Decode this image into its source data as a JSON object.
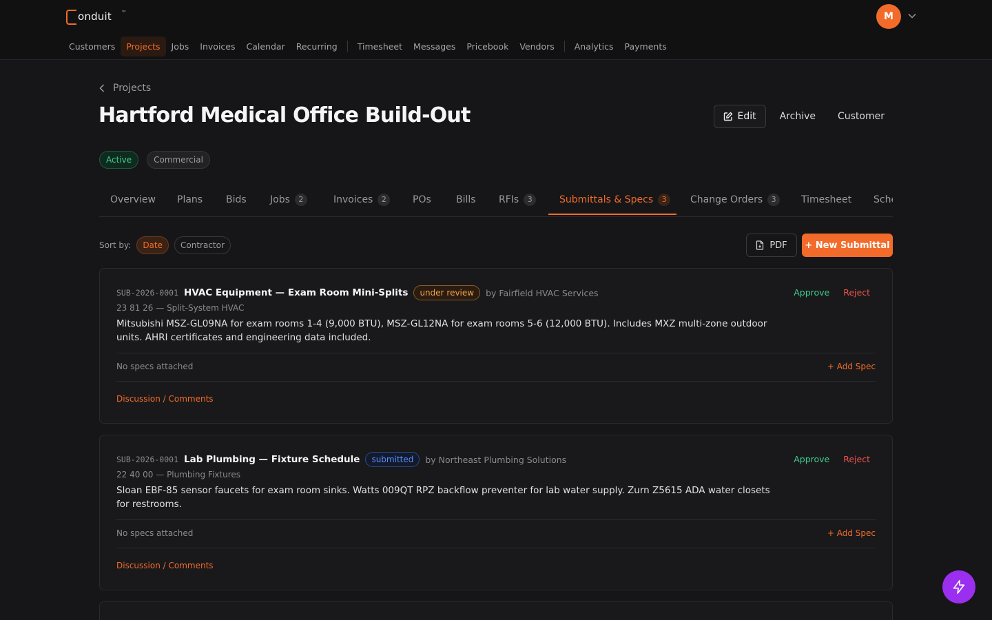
{
  "app": {
    "logo_text": "onduit",
    "logo_tm": "™",
    "avatar_initial": "M"
  },
  "nav": {
    "items": [
      "Customers",
      "Projects",
      "Jobs",
      "Invoices",
      "Calendar",
      "Recurring",
      "Timesheet",
      "Messages",
      "Pricebook",
      "Vendors",
      "Analytics",
      "Payments"
    ],
    "active": "Projects"
  },
  "project": {
    "back_label": "Projects",
    "title": "Hartford Medical Office Build-Out",
    "edit_label": "Edit",
    "archive_label": "Archive",
    "customer_label": "Customer",
    "status_badge": "Active",
    "type_badge": "Commercial"
  },
  "tabs": [
    {
      "label": "Overview",
      "count": null
    },
    {
      "label": "Plans",
      "count": null
    },
    {
      "label": "Bids",
      "count": null
    },
    {
      "label": "Jobs",
      "count": "2"
    },
    {
      "label": "Invoices",
      "count": "2"
    },
    {
      "label": "POs",
      "count": null
    },
    {
      "label": "Bills",
      "count": null
    },
    {
      "label": "RFIs",
      "count": "3"
    },
    {
      "label": "Submittals & Specs",
      "count": "3",
      "active": true
    },
    {
      "label": "Change Orders",
      "count": "3"
    },
    {
      "label": "Timesheet",
      "count": null
    },
    {
      "label": "Sche",
      "count": null
    }
  ],
  "toolbar": {
    "sort_label": "Sort by:",
    "sort_options": [
      "Date",
      "Contractor"
    ],
    "sort_active": "Date",
    "pdf_label": "PDF",
    "new_label": "+ New Submittal"
  },
  "submittals": [
    {
      "id": "SUB-2026-0001",
      "title": "HVAC Equipment — Exam Room Mini-Splits",
      "status": "under review",
      "byline": "by Fairfield HVAC Services",
      "spec_code": "23 81 26 — Split-System HVAC",
      "description": "Mitsubishi MSZ-GL09NA for exam rooms 1-4 (9,000 BTU), MSZ-GL12NA for exam rooms 5-6 (12,000 BTU). Includes MXZ multi-zone outdoor units. AHRI certificates and engineering data included.",
      "approve_label": "Approve",
      "reject_label": "Reject",
      "no_specs": "No specs attached",
      "add_spec": "+ Add Spec",
      "discussion": "Discussion / Comments"
    },
    {
      "id": "SUB-2026-0001",
      "title": "Lab Plumbing — Fixture Schedule",
      "status": "submitted",
      "byline": "by Northeast Plumbing Solutions",
      "spec_code": "22 40 00 — Plumbing Fixtures",
      "description": "Sloan EBF-85 sensor faucets for exam room sinks. Watts 009QT RPZ backflow preventer for lab water supply. Zurn Z5615 ADA water closets for restrooms.",
      "approve_label": "Approve",
      "reject_label": "Reject",
      "no_specs": "No specs attached",
      "add_spec": "+ Add Spec",
      "discussion": "Discussion / Comments"
    }
  ],
  "colors": {
    "accent": "#f26b2a",
    "approve": "#3ecf8e",
    "reject": "#f0524a",
    "fab": "#9b2ff0"
  },
  "icons": [
    "chevron-left-icon",
    "edit-icon",
    "file-pdf-icon",
    "chevron-down-icon",
    "lightning-icon"
  ]
}
